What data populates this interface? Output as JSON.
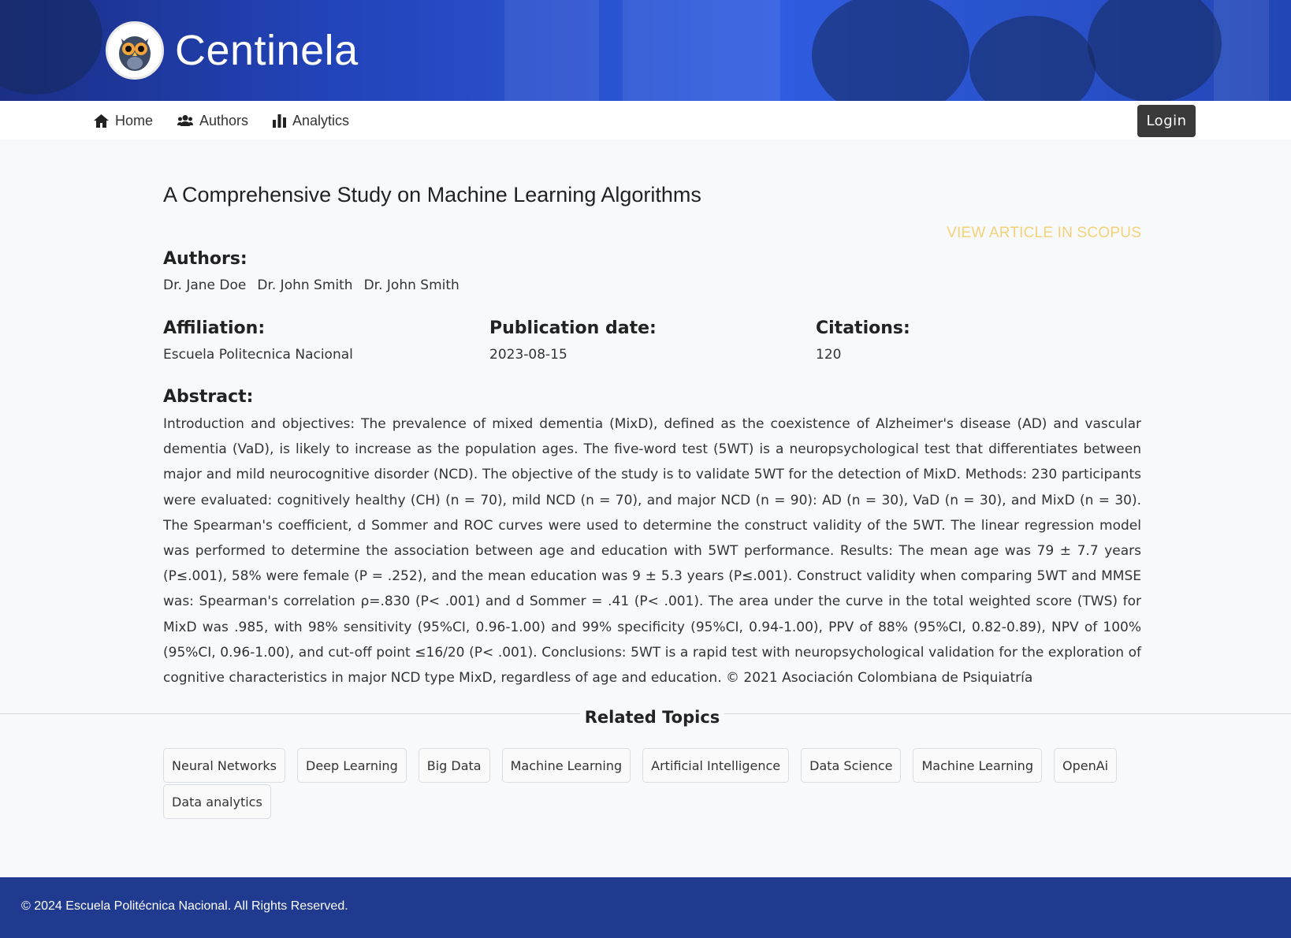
{
  "brand": {
    "name": "Centinela"
  },
  "nav": {
    "items": [
      {
        "label": "Home",
        "icon": "home-icon"
      },
      {
        "label": "Authors",
        "icon": "users-icon"
      },
      {
        "label": "Analytics",
        "icon": "bar-chart-icon"
      }
    ],
    "login_label": "Login"
  },
  "article": {
    "title": "A Comprehensive Study on Machine Learning Algorithms",
    "scopus_link_label": "View article in Scopus",
    "authors_label": "Authors:",
    "authors": [
      "Dr. Jane Doe",
      "Dr. John Smith",
      "Dr. John Smith"
    ],
    "affiliation_label": "Affiliation:",
    "affiliation": "Escuela Politecnica Nacional",
    "publication_date_label": "Publication date:",
    "publication_date": "2023-08-15",
    "citations_label": "Citations:",
    "citations": "120",
    "abstract_label": "Abstract:",
    "abstract": "Introduction and objectives: The prevalence of mixed dementia (MixD), defined as the coexistence of Alzheimer's disease (AD) and vascular dementia (VaD), is likely to increase as the population ages. The five-word test (5WT) is a neuropsychological test that differentiates between major and mild neurocognitive disorder (NCD). The objective of the study is to validate 5WT for the detection of MixD. Methods: 230 participants were evaluated: cognitively healthy (CH) (n = 70), mild NCD (n = 70), and major NCD (n = 90): AD (n = 30), VaD (n = 30), and MixD (n = 30). The Spearman's coefficient, d Sommer and ROC curves were used to determine the construct validity of the 5WT. The linear regression model was performed to determine the association between age and education with 5WT performance. Results: The mean age was 79 ± 7.7 years (P≤.001), 58% were female (P = .252), and the mean education was 9 ± 5.3 years (P≤.001). Construct validity when comparing 5WT and MMSE was: Spearman's correlation ρ=.830 (P< .001) and d Sommer = .41 (P< .001). The area under the curve in the total weighted score (TWS) for MixD was .985, with 98% sensitivity (95%CI, 0.96-1.00) and 99% specificity (95%CI, 0.94-1.00), PPV of 88% (95%CI, 0.82-0.89), NPV of 100% (95%CI, 0.96-1.00), and cut-off point ≤16/20 (P< .001). Conclusions: 5WT is a rapid test with neuropsychological validation for the exploration of cognitive characteristics in major NCD type MixD, regardless of age and education. © 2021 Asociación Colombiana de Psiquiatría"
  },
  "related": {
    "title": "Related Topics",
    "tags": [
      "Neural Networks",
      "Deep Learning",
      "Big Data",
      "Machine Learning",
      "Artificial Intelligence",
      "Data Science",
      "Machine Learning",
      "OpenAi",
      "Data analytics"
    ]
  },
  "footer": {
    "text": "© 2024 Escuela Politécnica Nacional. All Rights Reserved."
  },
  "colors": {
    "banner": "#2a52cf",
    "footer": "#1f3a8f",
    "scopus_link": "#f3d27a",
    "login_button": "#3a3a3a"
  }
}
